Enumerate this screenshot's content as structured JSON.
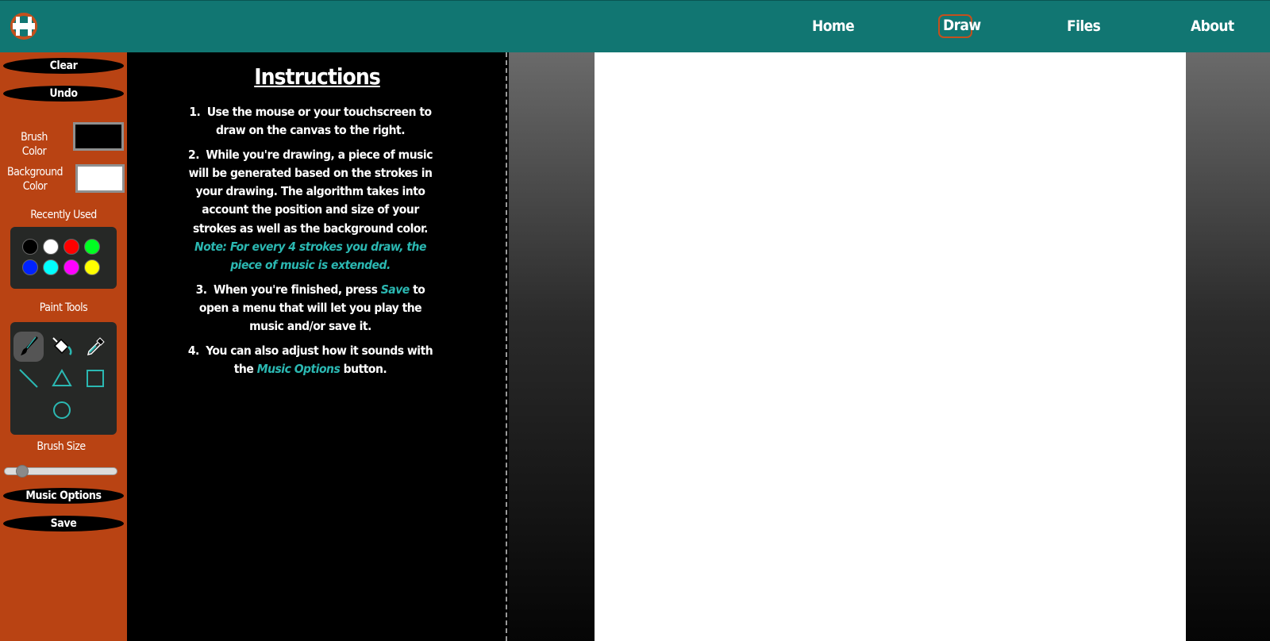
{
  "nav": {
    "home": "Home",
    "draw": "Draw",
    "files": "Files",
    "about": "About"
  },
  "sidebar": {
    "clear": "Clear",
    "undo": "Undo",
    "brush_color_label": "Brush Color",
    "brush_color_value": "#000000",
    "background_color_label": "Background Color",
    "background_color_value": "#ffffff",
    "recently_used_label": "Recently Used",
    "recent_colors": [
      "#000000",
      "#ffffff",
      "#ff0000",
      "#00ff22",
      "#0022ff",
      "#00ffff",
      "#ff00ff",
      "#ffff00"
    ],
    "paint_tools_label": "Paint Tools",
    "brush_size_label": "Brush Size",
    "brush_size_fraction": 0.12,
    "music_options": "Music Options",
    "save": "Save"
  },
  "instructions": {
    "title": "Instructions",
    "step1_num": "1.",
    "step1": "Use the mouse or your touchscreen to draw on the canvas to the right.",
    "step2_num": "2.",
    "step2": "While you're drawing, a piece of music will be generated based on the strokes in your drawing. The algorithm takes into account the position and size of your strokes as well as the background color.",
    "step2_note": "Note: For every 4 strokes you draw, the piece of music is extended.",
    "step3_num": "3.",
    "step3_a": "When you're finished, press",
    "step3_save": "Save",
    "step3_b": "to open a menu that will let you play the music and/or save it.",
    "step4_num": "4.",
    "step4_a": "You can also adjust how it sounds with the",
    "step4_music": "Music Options",
    "step4_b": "button."
  },
  "colors": {
    "header": "#117672",
    "sidebar": "#b94313",
    "accent": "#2bb8b2"
  }
}
